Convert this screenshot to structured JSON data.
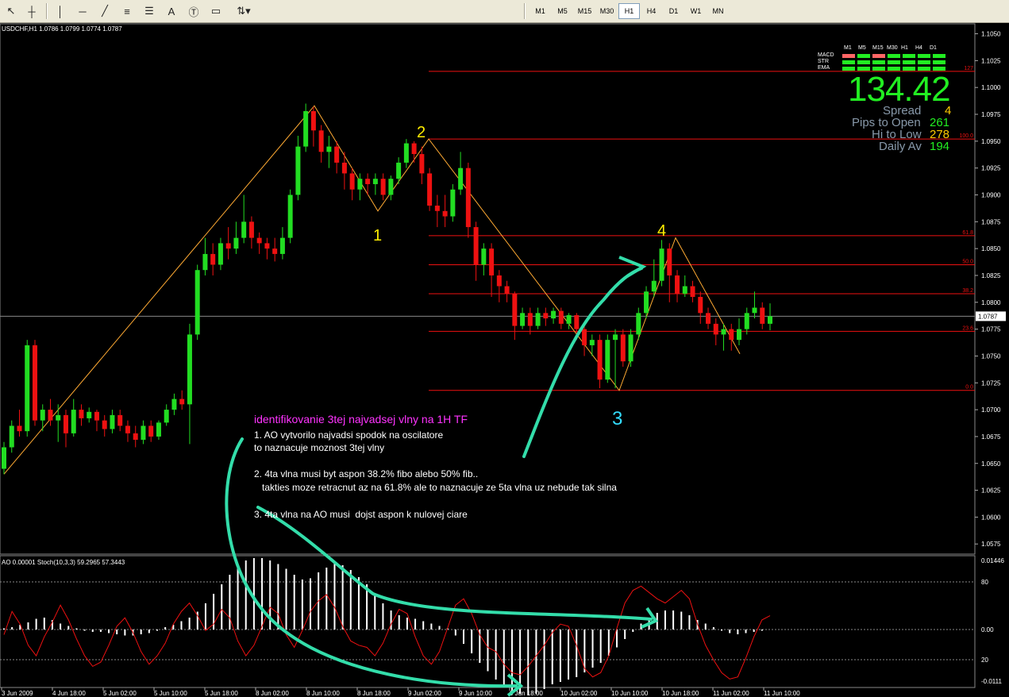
{
  "toolbar": {
    "timeframes": [
      "M1",
      "M5",
      "M15",
      "M30",
      "H1",
      "H4",
      "D1",
      "W1",
      "MN"
    ],
    "active": "H1"
  },
  "header": "USDCHF,H1  1.0786 1.0799 1.0774 1.0787",
  "subwindow_header": "AO 0.00001  Stoch(10,3,3) 59.2965 57.3443",
  "price_axis": [
    "1.1050",
    "1.1025",
    "1.1000",
    "1.0975",
    "1.0950",
    "1.0925",
    "1.0900",
    "1.0875",
    "1.0850",
    "1.0825",
    "1.0800",
    "1.0775",
    "1.0750",
    "1.0725",
    "1.0700",
    "1.0675",
    "1.0650",
    "1.0625",
    "1.0600",
    "1.0575"
  ],
  "current_price": "1.0787",
  "fibo_levels": [
    "127",
    "100.0",
    "61.8",
    "50.0",
    "38.2",
    "23.6",
    "0.0"
  ],
  "sub_axis": [
    "0.01446",
    "80",
    "0.00",
    "20",
    "-0.0111"
  ],
  "time_axis": [
    "3 Jun 2009",
    "4 Jun 18:00",
    "5 Jun 02:00",
    "5 Jun 10:00",
    "5 Jun 18:00",
    "8 Jun 02:00",
    "8 Jun 10:00",
    "8 Jun 18:00",
    "9 Jun 02:00",
    "9 Jun 10:00",
    "9 Jun 18:00",
    "10 Jun 02:00",
    "10 Jun 10:00",
    "10 Jun 18:00",
    "11 Jun 02:00",
    "11 Jun 10:00"
  ],
  "waves": {
    "w1": "1",
    "w2": "2",
    "w3": "3",
    "w4": "4"
  },
  "panel": {
    "timeframes": [
      "M1",
      "M5",
      "M15",
      "M30",
      "H1",
      "H4",
      "D1"
    ],
    "indicators": [
      "MACD",
      "STR",
      "EMA"
    ],
    "big_value": "134.42",
    "rows": [
      {
        "label": "Spread",
        "value": "4",
        "color": "#ffcc00"
      },
      {
        "label": "Pips to Open",
        "value": "261",
        "color": "#22ee22"
      },
      {
        "label": "Hi to Low",
        "value": "278",
        "color": "#ffcc00"
      },
      {
        "label": "Daily Av",
        "value": "194",
        "color": "#22ee22"
      }
    ]
  },
  "notes": {
    "title": "identifikovanie 3tej najvadsej vlny  na 1H TF",
    "lines": [
      "1. AO vytvorilo najvadsi spodok na oscilatore",
      "to naznacuje moznost 3tej vlny",
      "2. 4ta vlna musi byt aspon 38.2% fibo alebo 50% fib..",
      "   takties moze retracnut az na 61.8% ale to naznacuje ze 5ta vlna uz nebude tak silna",
      "3. 4ta vlna na AO musi  dojst aspon k nulovej ciare"
    ]
  },
  "colors": {
    "bull": "#22dd22",
    "bear": "#ee1111",
    "fibo": "#ee1111",
    "wave_line": "#ffaa33",
    "arrow": "#33ddaa",
    "wave_label": "#ffee00",
    "wave3_label": "#33ddff"
  },
  "candles": [
    [
      1.0645,
      1.0665,
      1.064,
      1.067
    ],
    [
      1.0665,
      1.0685,
      1.066,
      1.069
    ],
    [
      1.0685,
      1.068,
      1.0675,
      1.07
    ],
    [
      1.068,
      1.076,
      1.0675,
      1.0765
    ],
    [
      1.076,
      1.069,
      1.0685,
      1.0765
    ],
    [
      1.069,
      1.07,
      1.068,
      1.0705
    ],
    [
      1.07,
      1.069,
      1.0685,
      1.071
    ],
    [
      1.069,
      1.0695,
      1.067,
      1.0705
    ],
    [
      1.0695,
      1.0678,
      1.0665,
      1.07
    ],
    [
      1.0678,
      1.07,
      1.0675,
      1.071
    ],
    [
      1.07,
      1.0692,
      1.0685,
      1.0705
    ],
    [
      1.0692,
      1.0698,
      1.0688,
      1.0702
    ],
    [
      1.0698,
      1.069,
      1.068,
      1.07
    ],
    [
      1.069,
      1.0682,
      1.0675,
      1.0695
    ],
    [
      1.0682,
      1.0695,
      1.0678,
      1.07
    ],
    [
      1.0695,
      1.0685,
      1.068,
      1.07
    ],
    [
      1.0685,
      1.0678,
      1.067,
      1.069
    ],
    [
      1.0678,
      1.0672,
      1.0665,
      1.0685
    ],
    [
      1.0672,
      1.0685,
      1.0668,
      1.069
    ],
    [
      1.0685,
      1.0675,
      1.067,
      1.069
    ],
    [
      1.0675,
      1.0688,
      1.0672,
      1.069
    ],
    [
      1.0688,
      1.07,
      1.0685,
      1.0705
    ],
    [
      1.07,
      1.071,
      1.0695,
      1.0715
    ],
    [
      1.071,
      1.0705,
      1.07,
      1.0718
    ],
    [
      1.0705,
      1.077,
      1.0668,
      1.078
    ],
    [
      1.077,
      1.083,
      1.0765,
      1.0835
    ],
    [
      1.083,
      1.0845,
      1.0825,
      1.086
    ],
    [
      1.0845,
      1.0835,
      1.0825,
      1.0855
    ],
    [
      1.0835,
      1.0855,
      1.083,
      1.086
    ],
    [
      1.0855,
      1.085,
      1.084,
      1.087
    ],
    [
      1.085,
      1.086,
      1.0845,
      1.0875
    ],
    [
      1.086,
      1.0875,
      1.0855,
      1.09
    ],
    [
      1.0875,
      1.086,
      1.085,
      1.088
    ],
    [
      1.086,
      1.0855,
      1.0845,
      1.0865
    ],
    [
      1.0855,
      1.085,
      1.084,
      1.086
    ],
    [
      1.085,
      1.0845,
      1.0838,
      1.086
    ],
    [
      1.0845,
      1.086,
      1.084,
      1.087
    ],
    [
      1.086,
      1.09,
      1.0855,
      1.0905
    ],
    [
      1.09,
      1.0945,
      1.0895,
      1.0955
    ],
    [
      1.0945,
      1.0978,
      1.094,
      1.0985
    ],
    [
      1.0978,
      1.096,
      1.0945,
      1.0982
    ],
    [
      1.096,
      1.094,
      1.093,
      1.0965
    ],
    [
      1.094,
      1.0945,
      1.0925,
      1.0955
    ],
    [
      1.0945,
      1.093,
      1.092,
      1.095
    ],
    [
      1.093,
      1.092,
      1.0905,
      1.094
    ],
    [
      1.092,
      1.0905,
      1.0895,
      1.0925
    ],
    [
      1.0905,
      1.0915,
      1.0895,
      1.092
    ],
    [
      1.0915,
      1.091,
      1.09,
      1.092
    ],
    [
      1.091,
      1.0915,
      1.09,
      1.092
    ],
    [
      1.0915,
      1.09,
      1.0895,
      1.092
    ],
    [
      1.09,
      1.0915,
      1.0895,
      1.0918
    ],
    [
      1.0915,
      1.093,
      1.091,
      1.0935
    ],
    [
      1.093,
      1.0948,
      1.0925,
      1.0952
    ],
    [
      1.0948,
      1.0938,
      1.093,
      1.095
    ],
    [
      1.0938,
      1.092,
      1.091,
      1.0945
    ],
    [
      1.092,
      1.089,
      1.0885,
      1.0925
    ],
    [
      1.089,
      1.0885,
      1.087,
      1.09
    ],
    [
      1.0885,
      1.088,
      1.087,
      1.09
    ],
    [
      1.088,
      1.0905,
      1.0875,
      1.091
    ],
    [
      1.0905,
      1.0925,
      1.09,
      1.094
    ],
    [
      1.0925,
      1.087,
      1.086,
      1.093
    ],
    [
      1.087,
      1.0835,
      1.082,
      1.0875
    ],
    [
      1.0835,
      1.085,
      1.0825,
      1.0855
    ],
    [
      1.085,
      1.0825,
      1.0805,
      1.0855
    ],
    [
      1.0825,
      1.0815,
      1.08,
      1.083
    ],
    [
      1.0815,
      1.0808,
      1.08,
      1.082
    ],
    [
      1.0808,
      1.0778,
      1.0765,
      1.081
    ],
    [
      1.0778,
      1.079,
      1.0775,
      1.0795
    ],
    [
      1.079,
      1.0778,
      1.077,
      1.0795
    ],
    [
      1.0778,
      1.079,
      1.0775,
      1.0795
    ],
    [
      1.079,
      1.0785,
      1.0778,
      1.0795
    ],
    [
      1.0785,
      1.0792,
      1.078,
      1.0795
    ],
    [
      1.0792,
      1.078,
      1.0775,
      1.0795
    ],
    [
      1.078,
      1.0788,
      1.0775,
      1.079
    ],
    [
      1.0788,
      1.0775,
      1.0765,
      1.079
    ],
    [
      1.0775,
      1.076,
      1.075,
      1.078
    ],
    [
      1.076,
      1.0765,
      1.075,
      1.077
    ],
    [
      1.0765,
      1.0728,
      1.072,
      1.077
    ],
    [
      1.0728,
      1.0765,
      1.0725,
      1.077
    ],
    [
      1.0765,
      1.077,
      1.072,
      1.0775
    ],
    [
      1.077,
      1.0745,
      1.074,
      1.0775
    ],
    [
      1.0745,
      1.077,
      1.074,
      1.0775
    ],
    [
      1.077,
      1.079,
      1.0765,
      1.0795
    ],
    [
      1.079,
      1.081,
      1.0785,
      1.0815
    ],
    [
      1.081,
      1.082,
      1.0805,
      1.084
    ],
    [
      1.082,
      1.085,
      1.0815,
      1.0858
    ],
    [
      1.085,
      1.0825,
      1.08,
      1.0855
    ],
    [
      1.0825,
      1.0808,
      1.08,
      1.083
    ],
    [
      1.0808,
      1.0815,
      1.0805,
      1.0825
    ],
    [
      1.0815,
      1.0805,
      1.08,
      1.082
    ],
    [
      1.0805,
      1.079,
      1.078,
      1.081
    ],
    [
      1.079,
      1.078,
      1.0775,
      1.0795
    ],
    [
      1.078,
      1.077,
      1.076,
      1.0785
    ],
    [
      1.077,
      1.0775,
      1.0755,
      1.078
    ],
    [
      1.0775,
      1.0765,
      1.0755,
      1.078
    ],
    [
      1.0765,
      1.0775,
      1.076,
      1.0785
    ],
    [
      1.0775,
      1.079,
      1.077,
      1.0795
    ],
    [
      1.079,
      1.0795,
      1.0785,
      1.081
    ],
    [
      1.0795,
      1.078,
      1.0775,
      1.08
    ],
    [
      1.078,
      1.0787,
      1.0774,
      1.0799
    ]
  ],
  "ao": [
    0.1,
    0.2,
    0.4,
    0.6,
    0.9,
    1.0,
    0.8,
    0.5,
    0.3,
    0.1,
    -0.1,
    -0.2,
    -0.2,
    -0.3,
    -0.4,
    -0.5,
    -0.5,
    -0.4,
    -0.3,
    -0.1,
    0.2,
    0.4,
    0.7,
    1.0,
    1.5,
    2.2,
    3.0,
    3.8,
    4.6,
    5.3,
    5.8,
    6.0,
    6.0,
    5.8,
    5.5,
    5.1,
    4.6,
    4.2,
    4.3,
    4.8,
    5.2,
    5.6,
    5.4,
    5.0,
    4.4,
    3.8,
    3.0,
    2.2,
    1.6,
    1.2,
    1.0,
    0.9,
    0.7,
    0.5,
    0.3,
    0.1,
    -0.5,
    -1.2,
    -2.0,
    -2.8,
    -3.5,
    -4.2,
    -4.8,
    -5.2,
    -5.4,
    -5.5,
    -5.4,
    -5.0,
    -4.6,
    -4.4,
    -4.2,
    -4.0,
    -3.6,
    -3.2,
    -2.8,
    -2.2,
    -1.5,
    -0.8,
    -0.2,
    0.5,
    1.0,
    1.4,
    1.6,
    1.6,
    1.5,
    1.2,
    0.8,
    0.5,
    0.2,
    -0.1,
    -0.3,
    -0.4,
    -0.3,
    -0.2,
    -0.1,
    0.0
  ],
  "stoch": [
    50,
    72,
    60,
    40,
    30,
    48,
    62,
    78,
    64,
    46,
    30,
    20,
    24,
    40,
    58,
    66,
    52,
    34,
    22,
    30,
    42,
    60,
    72,
    80,
    68,
    54,
    60,
    74,
    66,
    44,
    30,
    40,
    58,
    76,
    70,
    50,
    38,
    54,
    72,
    82,
    88,
    76,
    58,
    44,
    40,
    38,
    30,
    42,
    60,
    74,
    70,
    48,
    30,
    22,
    34,
    56,
    78,
    84,
    70,
    50,
    38,
    34,
    22,
    14,
    12,
    20,
    30,
    40,
    52,
    60,
    58,
    40,
    18,
    10,
    14,
    30,
    56,
    80,
    92,
    96,
    90,
    84,
    80,
    86,
    92,
    84,
    60,
    40,
    26,
    14,
    8,
    10,
    28,
    48,
    64,
    68
  ]
}
